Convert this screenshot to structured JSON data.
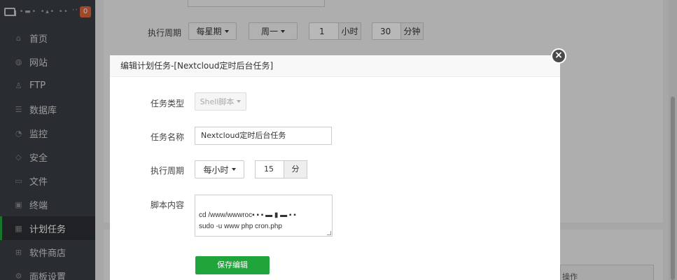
{
  "sidebar": {
    "host": "•▬• •▴•  •• ''",
    "badge": "0",
    "items": [
      {
        "label": "首页",
        "icon": "home-icon",
        "glyph": "⌂"
      },
      {
        "label": "网站",
        "icon": "globe-icon",
        "glyph": "◍"
      },
      {
        "label": "FTP",
        "icon": "ftp-user-icon",
        "glyph": "♙"
      },
      {
        "label": "数据库",
        "icon": "database-icon",
        "glyph": "☰"
      },
      {
        "label": "监控",
        "icon": "monitor-icon",
        "glyph": "◔"
      },
      {
        "label": "安全",
        "icon": "shield-icon",
        "glyph": "◇"
      },
      {
        "label": "文件",
        "icon": "folder-icon",
        "glyph": "▭"
      },
      {
        "label": "终端",
        "icon": "terminal-icon",
        "glyph": "▣"
      },
      {
        "label": "计划任务",
        "icon": "calendar-icon",
        "glyph": "▦"
      },
      {
        "label": "软件商店",
        "icon": "apps-grid-icon",
        "glyph": "⊞"
      },
      {
        "label": "面板设置",
        "icon": "settings-gear-icon",
        "glyph": "⚙"
      }
    ]
  },
  "background": {
    "period_label": "执行周期",
    "week_select": "每星期",
    "day_select": "周一",
    "hour_value": "1",
    "hour_unit": "小时",
    "minute_value": "30",
    "minute_unit": "分钟",
    "table_header": "操作"
  },
  "modal": {
    "title": "编辑计划任务-[Nextcloud定时后台任务]",
    "close": "×",
    "task_type_label": "任务类型",
    "task_type_value": "Shell脚本",
    "task_name_label": "任务名称",
    "task_name_value": "Nextcloud定时后台任务",
    "period_label": "执行周期",
    "period_value": "每小时",
    "minute_value": "15",
    "minute_unit": "分",
    "script_label": "脚本内容",
    "script_value": "cd /www/wwwroc▪ ▪ ▪ ▬  ▮  ▬ ▪ ▪\nsudo -u www php cron.php",
    "save_button": "保存编辑"
  },
  "colors": {
    "primary": "#20a53a",
    "sidebar_bg": "#3a3f44",
    "badge": "#e0643b"
  }
}
